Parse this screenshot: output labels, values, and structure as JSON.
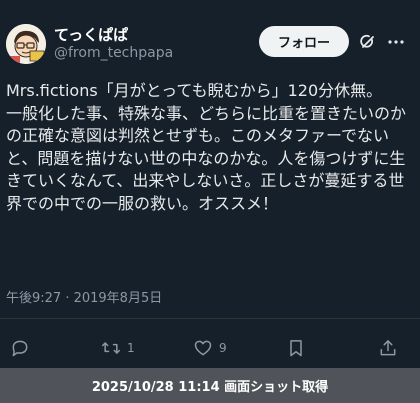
{
  "user": {
    "name": "てっくぱぱ",
    "handle": "@from_techpapa"
  },
  "header": {
    "follow_label": "フォロー",
    "grok_icon": "grok-icon",
    "more_icon": "more-icon"
  },
  "tweet": {
    "text": "Mrs.fictions「月がとっても睨むから」120分休無。\n一般化した事、特殊な事、どちらに比重を置きたいのかの正確な意図は判然とせずも。このメタファーでないと、問題を描けない世の中なのかな。人を傷つけずに生きていくなんて、出来やしないさ。正しさが蔓延する世界での中での一服の救い。オススメ！",
    "timestamp": "午後9:27 · 2019年8月5日"
  },
  "actions": {
    "reply_icon": "reply-icon",
    "retweet_count": "1",
    "like_count": "9",
    "bookmark_icon": "bookmark-icon",
    "share_icon": "share-icon"
  },
  "footer": {
    "caption": "2025/10/28 11:14 画面ショット取得"
  },
  "colors": {
    "background": "#15202b",
    "text": "#e7e9ea",
    "secondary": "#8b98a5",
    "footer_bg": "#50545a"
  }
}
